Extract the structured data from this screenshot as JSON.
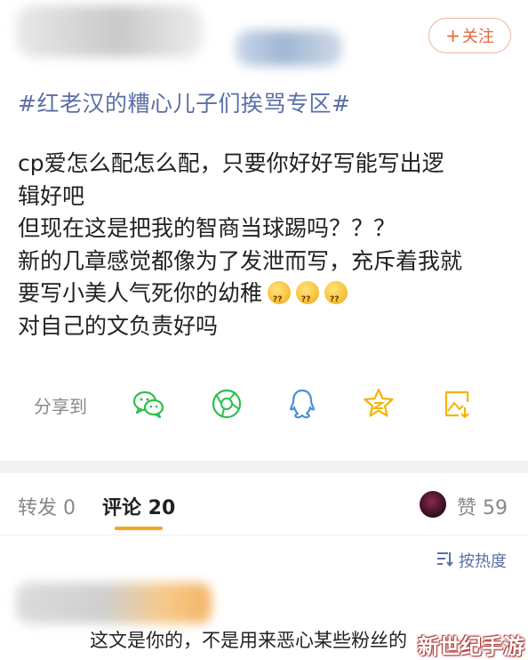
{
  "header": {
    "follow_button": {
      "icon": "plus-icon",
      "label": "关注"
    }
  },
  "post": {
    "topic": "#红老汉的糟心儿子们挨骂专区#",
    "lines": [
      "cp爱怎么配怎么配，只要你好好写能写出逻",
      "辑好吧",
      "但现在这是把我的智商当球踢吗？？？",
      "新的几章感觉都像为了发泄而写，充斥着我就",
      "要写小美人气死你的幼稚",
      "对自己的文负责好吗"
    ],
    "emojis": [
      "confused-emoji",
      "confused-emoji",
      "confused-emoji"
    ]
  },
  "share": {
    "label": "分享到",
    "icons": [
      "wechat-icon",
      "moments-icon",
      "qq-icon",
      "qzone-icon",
      "save-image-icon"
    ]
  },
  "tabs": {
    "repost": "转发 0",
    "comment": "评论 20",
    "like": "赞 59"
  },
  "sort": {
    "icon": "sort-icon",
    "label": "按热度"
  },
  "comment": {
    "text": "这文是你的，不是用来恶心某些粉丝的"
  },
  "watermark": "新世纪手游",
  "colors": {
    "accent_orange": "#e8663c",
    "link_blue": "#5b6fa6",
    "tab_underline": "#f5a623",
    "share_green": "#2dbf4e",
    "share_blue": "#4a90d9",
    "share_yellow": "#f5b400"
  }
}
